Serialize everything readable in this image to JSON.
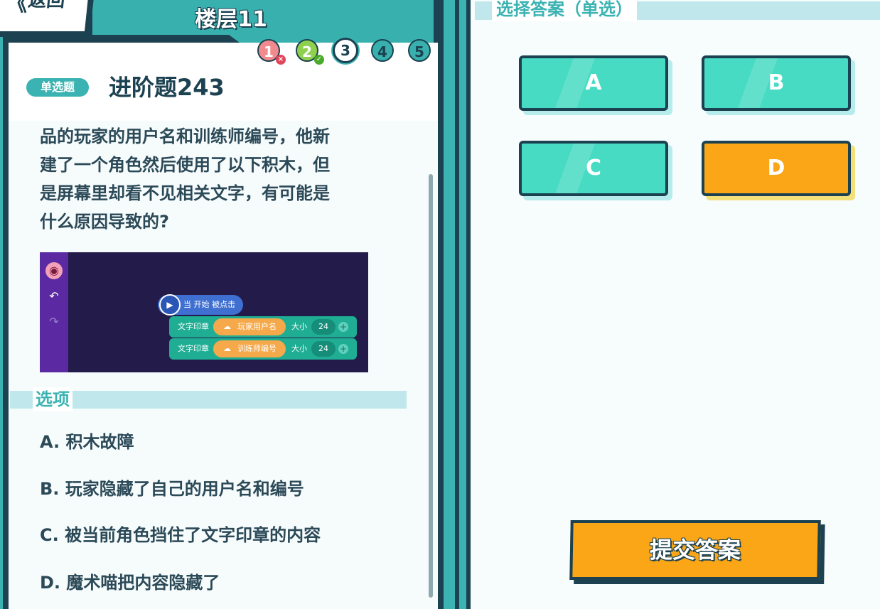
{
  "header": {
    "back_label": "返回",
    "floor_title": "楼层11"
  },
  "progress": [
    {
      "label": "1",
      "status": "wrong"
    },
    {
      "label": "2",
      "status": "correct"
    },
    {
      "label": "3",
      "status": "current"
    },
    {
      "label": "4",
      "status": "pending"
    },
    {
      "label": "5",
      "status": "pending"
    }
  ],
  "question": {
    "type_badge": "单选题",
    "title": "进阶题243",
    "text_lines": [
      "品的玩家的用户名和训练师编号，他新",
      "建了一个角色然后使用了以下积木，但",
      "是屏幕里却看不见相关文字，有可能是",
      "什么原因导致的?"
    ]
  },
  "code_image": {
    "hat_label": "当 开始 被点击",
    "blocks": [
      {
        "label": "文字印章",
        "variable": "玩家用户名",
        "size_label": "大小",
        "size": "24"
      },
      {
        "label": "文字印章",
        "variable": "训练师编号",
        "size_label": "大小",
        "size": "24"
      }
    ]
  },
  "options": {
    "title": "选项",
    "items": [
      "A. 积木故障",
      "B. 玩家隐藏了自己的用户名和编号",
      "C. 被当前角色挡住了文字印章的内容",
      "D. 魔术喵把内容隐藏了"
    ]
  },
  "answer_panel": {
    "title": "选择答案（单选）",
    "choices": [
      {
        "label": "A",
        "selected": false
      },
      {
        "label": "B",
        "selected": false
      },
      {
        "label": "C",
        "selected": false
      },
      {
        "label": "D",
        "selected": true
      }
    ],
    "submit_label": "提交答案"
  },
  "colors": {
    "teal": "#3bb3b2",
    "navy": "#1c4150",
    "answer_green": "#47dbc4",
    "selected_orange": "#fba616",
    "wrong_red": "#f08a8e",
    "correct_green": "#8fd14f"
  }
}
